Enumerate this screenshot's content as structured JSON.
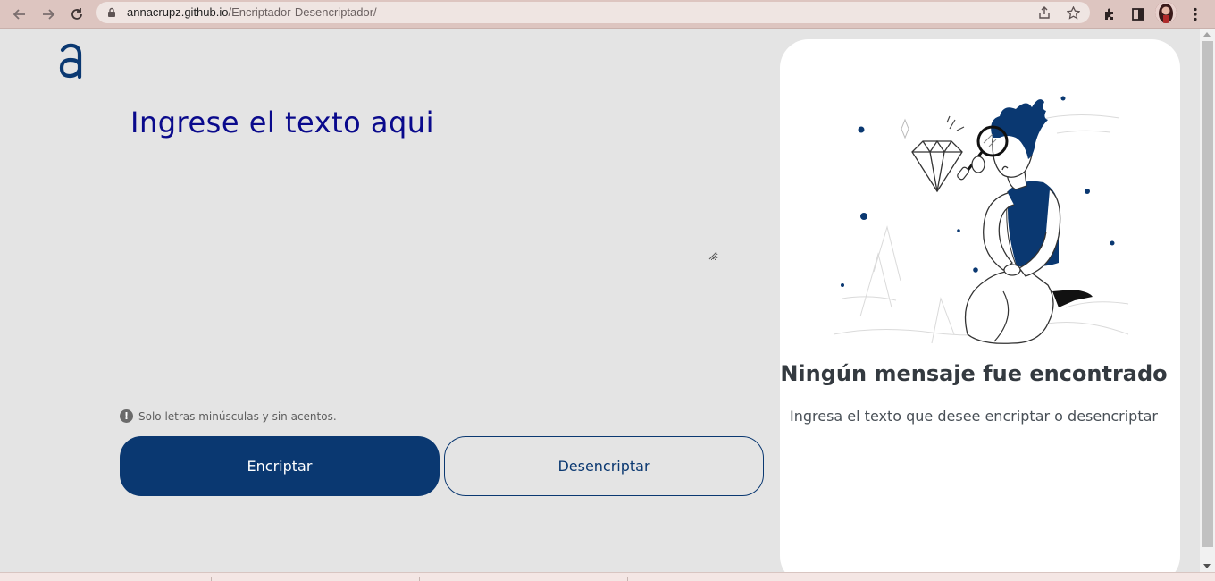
{
  "browser": {
    "url_host": "annacrupz.github.io",
    "url_path": "/Encriptador-Desencriptador/",
    "icons": {
      "back": "arrow-left-icon",
      "forward": "arrow-right-icon",
      "reload": "reload-icon",
      "lock": "lock-icon",
      "share": "share-icon",
      "bookmark": "star-icon",
      "extensions": "puzzle-icon",
      "side_panel": "side-panel-icon",
      "profile": "avatar",
      "menu": "kebab-menu-icon"
    }
  },
  "main": {
    "logo": "a",
    "input": {
      "placeholder": "Ingrese el texto aqui",
      "value": ""
    },
    "hint": "Solo letras minúsculas y sin acentos.",
    "buttons": {
      "encrypt": "Encriptar",
      "decrypt": "Desencriptar"
    }
  },
  "output": {
    "title": "Ningún mensaje fue encontrado",
    "subtitle": "Ingresa el texto que desee encriptar o desencriptar"
  },
  "colors": {
    "primary": "#0a3871",
    "background": "#e4e4e4",
    "card": "#ffffff",
    "title_text": "#0a0a8c"
  }
}
